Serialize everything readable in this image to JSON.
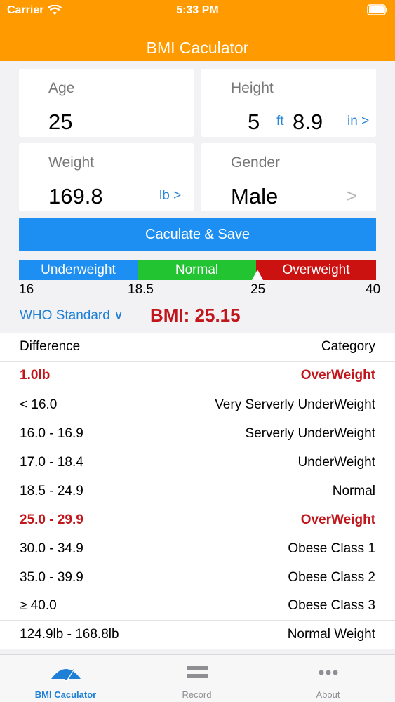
{
  "status_bar": {
    "carrier": "Carrier",
    "time": "5:33 PM"
  },
  "nav": {
    "title": "BMI Caculator"
  },
  "inputs": {
    "age": {
      "label": "Age",
      "value": "25"
    },
    "height": {
      "label": "Height",
      "feet": "5",
      "feet_unit": "ft",
      "inches": "8.9",
      "inches_unit": "in >"
    },
    "weight": {
      "label": "Weight",
      "value": "169.8",
      "unit": "lb >"
    },
    "gender": {
      "label": "Gender",
      "value": "Male",
      "chevron": ">"
    }
  },
  "calculate_button": "Caculate & Save",
  "bmi_bar": {
    "segments": [
      {
        "label": "Underweight",
        "color": "#1e8ff2"
      },
      {
        "label": "Normal",
        "color": "#22c431"
      },
      {
        "label": "Overweight",
        "color": "#cc1111"
      }
    ],
    "ticks": [
      "16",
      "18.5",
      "25",
      "40"
    ],
    "pointer_value": 25.15
  },
  "standard": "WHO Standard ∨",
  "bmi_result": "BMI: 25.15",
  "table": {
    "header": {
      "left": "Difference",
      "right": "Category"
    },
    "current": {
      "left": "1.0lb",
      "right": "OverWeight"
    },
    "rows": [
      {
        "left": "< 16.0",
        "right": "Very Serverly UnderWeight"
      },
      {
        "left": "16.0 - 16.9",
        "right": "Serverly UnderWeight"
      },
      {
        "left": "17.0 - 18.4",
        "right": "UnderWeight"
      },
      {
        "left": "18.5 - 24.9",
        "right": "Normal"
      },
      {
        "left": "25.0 - 29.9",
        "right": "OverWeight"
      },
      {
        "left": "30.0 - 34.9",
        "right": "Obese Class 1"
      },
      {
        "left": "35.0 - 39.9",
        "right": "Obese Class 2"
      },
      {
        "left": "≥ 40.0",
        "right": "Obese Class 3"
      }
    ],
    "normal_range": {
      "left": "124.9lb - 168.8lb",
      "right": "Normal Weight"
    }
  },
  "tabs": [
    {
      "label": "BMI Caculator",
      "icon": "gauge-icon",
      "active": true
    },
    {
      "label": "Record",
      "icon": "list-icon",
      "active": false
    },
    {
      "label": "About",
      "icon": "more-icon",
      "active": false
    }
  ],
  "colors": {
    "header": "#ff9a00",
    "accent": "#1e8ff2",
    "highlight_red": "#c1161b"
  }
}
